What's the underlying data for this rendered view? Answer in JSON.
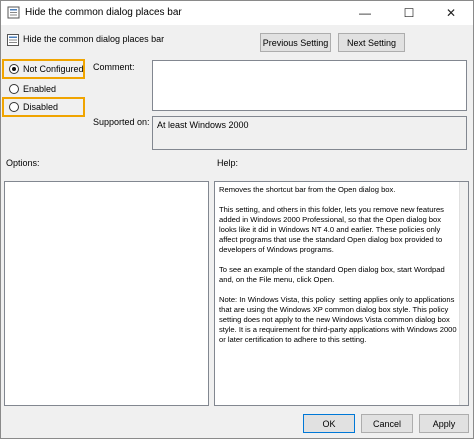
{
  "window": {
    "title": "Hide the common dialog places bar",
    "controls": {
      "minimize": "—",
      "maximize": "☐",
      "close": "✕"
    }
  },
  "header": {
    "title": "Hide the common dialog places bar",
    "prev_button": "Previous Setting",
    "next_button": "Next Setting"
  },
  "state": {
    "options": [
      {
        "label": "Not Configured",
        "checked": true
      },
      {
        "label": "Enabled",
        "checked": false
      },
      {
        "label": "Disabled",
        "checked": false
      }
    ]
  },
  "fields": {
    "comment_label": "Comment:",
    "comment_value": "",
    "supported_label": "Supported on:",
    "supported_value": "At least Windows 2000"
  },
  "panels": {
    "options_label": "Options:",
    "help_label": "Help:",
    "help_text": "Removes the shortcut bar from the Open dialog box.\n\nThis setting, and others in this folder, lets you remove new features added in Windows 2000 Professional, so that the Open dialog box looks like it did in Windows NT 4.0 and earlier. These policies only affect programs that use the standard Open dialog box provided to developers of Windows programs.\n\nTo see an example of the standard Open dialog box, start Wordpad and, on the File menu, click Open.\n\nNote: In Windows Vista, this policy  setting applies only to applications that are using the Windows XP common dialog box style. This policy setting does not apply to the new Windows Vista common dialog box style. It is a requirement for third-party applications with Windows 2000 or later certification to adhere to this setting."
  },
  "footer": {
    "ok": "OK",
    "cancel": "Cancel",
    "apply": "Apply"
  },
  "colors": {
    "highlight": "#f0a400",
    "default_button_border": "#0078d7"
  }
}
